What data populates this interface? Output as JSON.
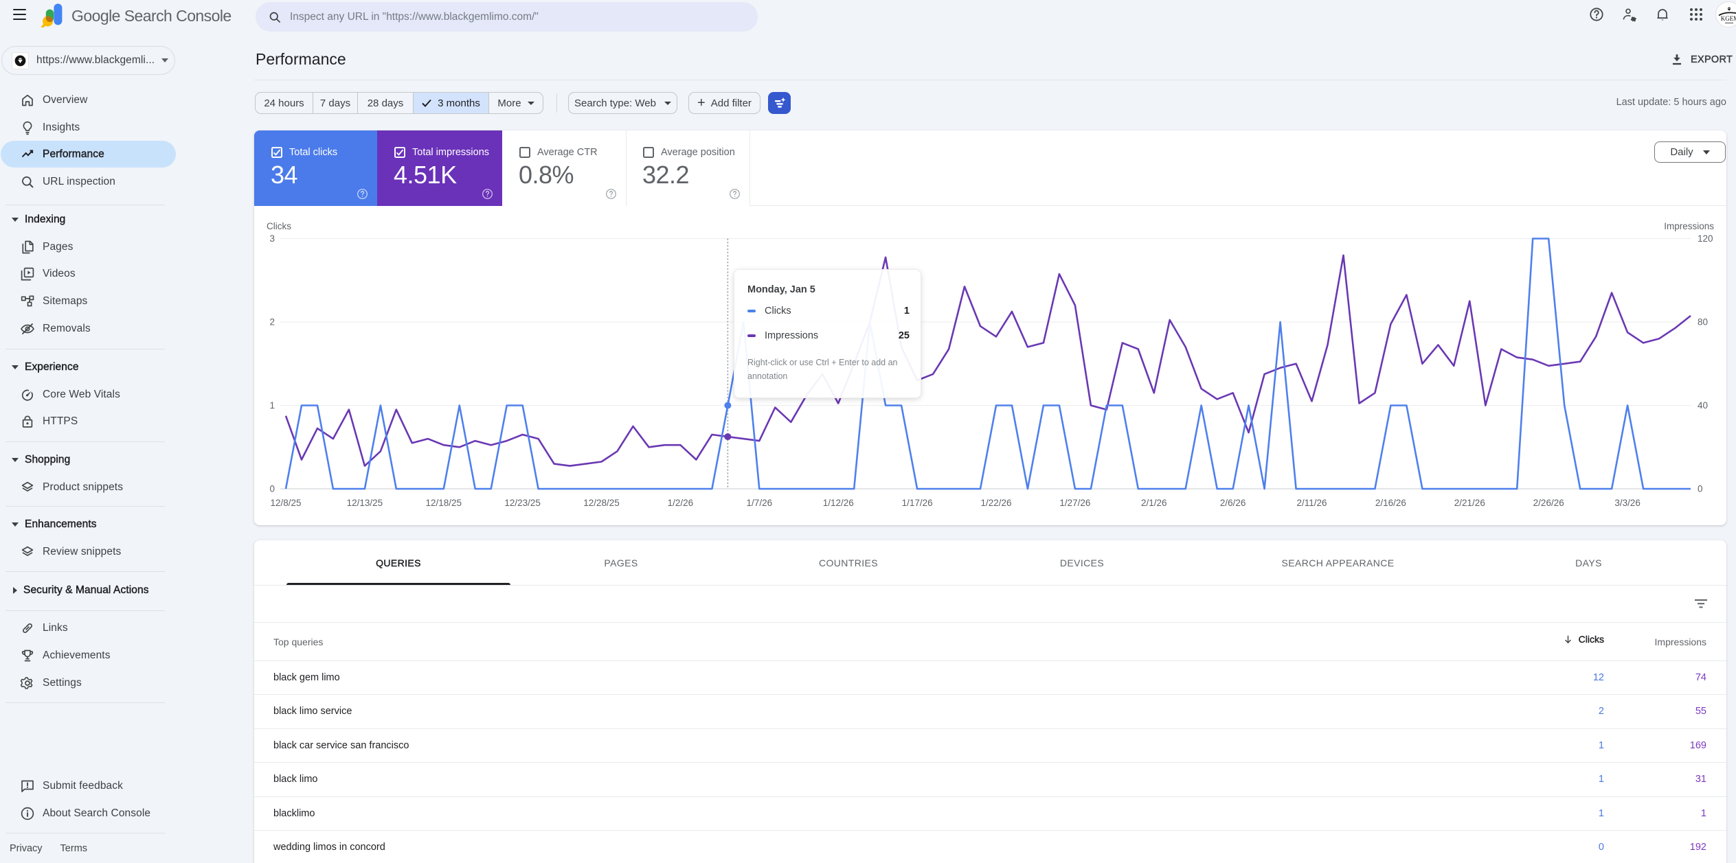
{
  "app": {
    "brand": "Google",
    "product": "Search Console"
  },
  "topbar": {
    "search_placeholder": "Inspect any URL in \"https://www.blackgemlimo.com/\"",
    "icons": [
      "menu-icon",
      "help-icon",
      "user-settings-icon",
      "notifications-icon",
      "google-apps-icon",
      "account-avatar"
    ]
  },
  "property": {
    "label": "https://www.blackgemli...",
    "avatar_text": "KGEM"
  },
  "sidebar": {
    "items_top": [
      {
        "label": "Overview",
        "icon": "home-icon",
        "selected": false
      },
      {
        "label": "Insights",
        "icon": "lightbulb-icon",
        "selected": false
      },
      {
        "label": "Performance",
        "icon": "trending-up-icon",
        "selected": true
      },
      {
        "label": "URL inspection",
        "icon": "search-icon",
        "selected": false
      }
    ],
    "sections": [
      {
        "header": "Indexing",
        "expanded": true,
        "items": [
          {
            "label": "Pages",
            "icon": "pages-icon"
          },
          {
            "label": "Videos",
            "icon": "video-library-icon"
          },
          {
            "label": "Sitemaps",
            "icon": "sitemap-icon"
          },
          {
            "label": "Removals",
            "icon": "eye-off-icon"
          }
        ]
      },
      {
        "header": "Experience",
        "expanded": true,
        "items": [
          {
            "label": "Core Web Vitals",
            "icon": "gauge-icon"
          },
          {
            "label": "HTTPS",
            "icon": "lock-icon"
          }
        ]
      },
      {
        "header": "Shopping",
        "expanded": true,
        "items": [
          {
            "label": "Product snippets",
            "icon": "layers-icon"
          }
        ]
      },
      {
        "header": "Enhancements",
        "expanded": true,
        "items": [
          {
            "label": "Review snippets",
            "icon": "layers-icon"
          }
        ]
      },
      {
        "header": "Security & Manual Actions",
        "expanded": false,
        "items": []
      }
    ],
    "items_bottom": [
      {
        "label": "Links",
        "icon": "link-icon"
      },
      {
        "label": "Achievements",
        "icon": "trophy-icon"
      },
      {
        "label": "Settings",
        "icon": "gear-icon"
      }
    ],
    "items_footer": [
      {
        "label": "Submit feedback",
        "icon": "feedback-icon"
      },
      {
        "label": "About Search Console",
        "icon": "info-icon"
      }
    ],
    "privacy": "Privacy",
    "terms": "Terms"
  },
  "header": {
    "title": "Performance",
    "export_label": "EXPORT"
  },
  "filters": {
    "date_ranges": [
      "24 hours",
      "7 days",
      "28 days",
      "3 months"
    ],
    "selected_range": "3 months",
    "more_label": "More",
    "search_type": "Search type: Web",
    "add_filter": "Add filter",
    "last_update": "Last update: 5 hours ago"
  },
  "metrics_bar": {
    "granularity": "Daily",
    "cards": [
      {
        "label": "Total clicks",
        "value": "34",
        "checked": true,
        "color": "#4b7bea"
      },
      {
        "label": "Total impressions",
        "value": "4.51K",
        "checked": true,
        "color": "#6a31b9"
      },
      {
        "label": "Average CTR",
        "value": "0.8%",
        "checked": false,
        "color": "#ffffff"
      },
      {
        "label": "Average position",
        "value": "32.2",
        "checked": false,
        "color": "#ffffff"
      }
    ]
  },
  "tooltip": {
    "title": "Monday, Jan 5",
    "clicks_label": "Clicks",
    "clicks_value": "1",
    "impressions_label": "Impressions",
    "impressions_value": "25",
    "note": "Right-click or use Ctrl + Enter to add an annotation",
    "day_index": 28
  },
  "chart_data": {
    "type": "line",
    "title": "",
    "x_start_date": "12/8/25",
    "x_tick_labels": [
      "12/8/25",
      "12/13/25",
      "12/18/25",
      "12/23/25",
      "12/28/25",
      "1/2/26",
      "1/7/26",
      "1/12/26",
      "1/17/26",
      "1/22/26",
      "1/27/26",
      "2/1/26",
      "2/6/26",
      "2/11/26",
      "2/16/26",
      "2/21/26",
      "2/26/26",
      "3/3/26"
    ],
    "x_tick_every_days": 5,
    "left_axis": {
      "title": "Clicks",
      "ticks": [
        0,
        1,
        2,
        3
      ],
      "range": [
        0,
        3
      ]
    },
    "right_axis": {
      "title": "Impressions",
      "ticks": [
        0,
        40,
        80,
        120
      ],
      "range": [
        0,
        120
      ]
    },
    "grid": true,
    "legend_position": "none",
    "series": [
      {
        "name": "Clicks",
        "color": "#4e80ed",
        "axis": "left",
        "values": [
          0,
          1,
          1,
          0,
          0,
          0,
          1,
          0,
          0,
          0,
          0,
          1,
          0,
          0,
          1,
          1,
          0,
          0,
          0,
          0,
          0,
          0,
          0,
          0,
          0,
          0,
          0,
          0,
          1,
          2,
          0,
          0,
          0,
          0,
          0,
          0,
          0,
          2,
          1,
          1,
          0,
          0,
          0,
          0,
          0,
          1,
          1,
          0,
          1,
          1,
          0,
          0,
          1,
          1,
          0,
          0,
          0,
          0,
          1,
          0,
          0,
          1,
          0,
          2,
          0,
          0,
          0,
          0,
          0,
          0,
          1,
          1,
          0,
          0,
          0,
          0,
          0,
          0,
          0,
          3,
          3,
          1,
          0,
          0,
          0,
          1,
          0,
          0,
          0,
          0
        ]
      },
      {
        "name": "Impressions",
        "color": "#6a38b3",
        "axis": "right",
        "values": [
          35,
          14,
          29,
          24,
          38,
          11,
          18,
          38,
          22,
          24,
          21,
          20,
          23,
          21,
          23,
          26,
          24,
          12,
          11,
          12,
          13,
          18,
          30,
          20,
          21,
          21,
          14,
          26,
          25,
          24,
          23,
          39,
          32,
          45,
          55,
          41,
          60,
          80,
          111,
          68,
          52,
          55,
          67,
          97,
          78,
          73,
          85,
          68,
          70,
          103,
          88,
          40,
          38,
          70,
          67,
          46,
          81,
          68,
          48,
          43,
          46,
          27,
          55,
          58,
          60,
          42,
          69,
          112,
          41,
          46,
          79,
          93,
          60,
          69,
          59,
          90,
          40,
          67,
          63,
          62,
          59,
          60,
          61,
          73,
          94,
          75,
          70,
          72,
          77,
          83
        ]
      }
    ]
  },
  "table": {
    "tabs": [
      "QUERIES",
      "PAGES",
      "COUNTRIES",
      "DEVICES",
      "SEARCH APPEARANCE",
      "DAYS"
    ],
    "active_tab": "QUERIES",
    "col_queries": "Top queries",
    "col_clicks": "Clicks",
    "col_impressions": "Impressions",
    "sort": {
      "column": "Clicks",
      "direction": "desc"
    },
    "rows": [
      {
        "query": "black gem limo",
        "clicks": "12",
        "impressions": "74"
      },
      {
        "query": "black limo service",
        "clicks": "2",
        "impressions": "55"
      },
      {
        "query": "black car service san francisco",
        "clicks": "1",
        "impressions": "169"
      },
      {
        "query": "black limo",
        "clicks": "1",
        "impressions": "31"
      },
      {
        "query": "blacklimo",
        "clicks": "1",
        "impressions": "1"
      },
      {
        "query": "wedding limos in concord",
        "clicks": "0",
        "impressions": "192"
      }
    ]
  }
}
